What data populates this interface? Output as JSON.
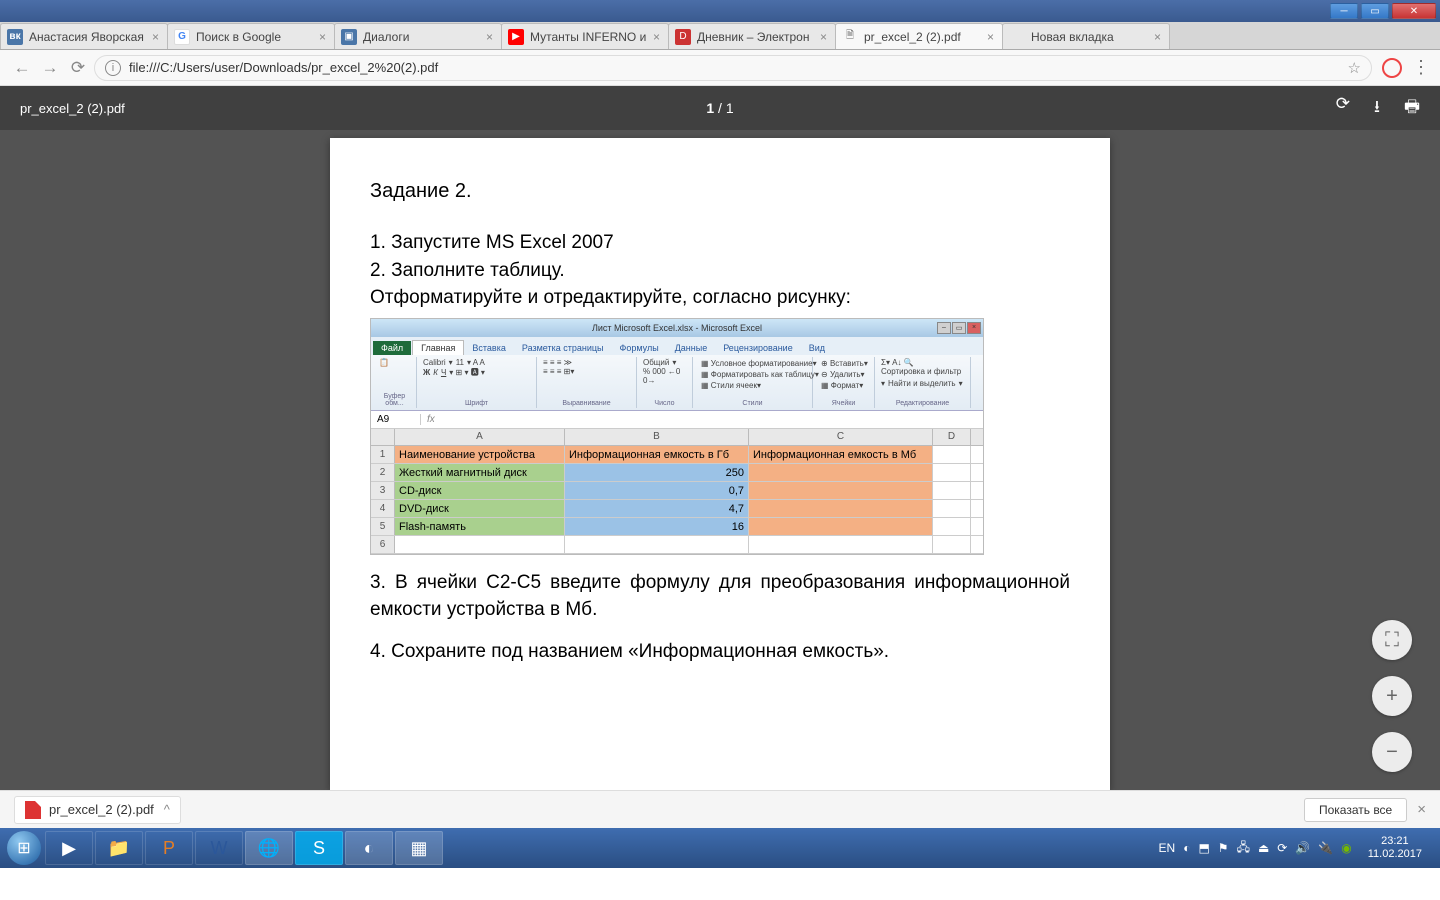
{
  "tabs": [
    {
      "label": "Анастасия Яворская",
      "fav": "vk",
      "favtxt": "вк"
    },
    {
      "label": "Поиск в Google",
      "fav": "g",
      "favtxt": "G"
    },
    {
      "label": "Диалоги",
      "fav": "dlg",
      "favtxt": "▣"
    },
    {
      "label": "Мутанты INFERNO и",
      "fav": "yt",
      "favtxt": "▶"
    },
    {
      "label": "Дневник – Электрон",
      "fav": "d",
      "favtxt": "D"
    },
    {
      "label": "pr_excel_2 (2).pdf",
      "fav": "pdf",
      "favtxt": "🗎",
      "active": true
    },
    {
      "label": "Новая вкладка",
      "fav": "pdf",
      "favtxt": ""
    }
  ],
  "url": "file:///C:/Users/user/Downloads/pr_excel_2%20(2).pdf",
  "pdf": {
    "filename": "pr_excel_2 (2).pdf",
    "page_cur": "1",
    "page_sep": "/",
    "page_tot": "1"
  },
  "doc": {
    "title": "Задание 2.",
    "l1": "1. Запустите MS Excel 2007",
    "l2": "2. Заполните таблицу.",
    "l3": "Отформатируйте и отредактируйте, согласно рисунку:",
    "l4": "3. В ячейки С2-С5 введите формулу для преобразования информационной емкости устройства в Мб.",
    "l5": "4. Сохраните под названием «Информационная емкость»."
  },
  "excel": {
    "title": "Лист Microsoft Excel.xlsx - Microsoft Excel",
    "tabs": {
      "file": "Файл",
      "home": "Главная",
      "insert": "Вставка",
      "layout": "Разметка страницы",
      "formulas": "Формулы",
      "data": "Данные",
      "review": "Рецензирование",
      "view": "Вид"
    },
    "groups": {
      "clip": "Буфер обм...",
      "font": "Шрифт",
      "align": "Выравнивание",
      "num": "Число",
      "styles": "Стили",
      "cells": "Ячейки",
      "edit": "Редактирование"
    },
    "ribbon": {
      "fontname": "Calibri",
      "fontsize": "11",
      "numfmt": "Общий",
      "cond": "Условное форматирование",
      "fmttbl": "Форматировать как таблицу",
      "cellsty": "Стили ячеек",
      "ins": "Вставить",
      "del": "Удалить",
      "fmt": "Формат",
      "sort": "Сортировка и фильтр",
      "find": "Найти и выделить"
    },
    "namebox": "A9",
    "cols": [
      "A",
      "B",
      "C",
      "D"
    ],
    "rows": [
      {
        "n": "1",
        "a": "Наименование устройства",
        "b": "Информационная емкость в Гб",
        "c": "Информационная емкость в Мб",
        "hdr": true
      },
      {
        "n": "2",
        "a": "Жесткий магнитный диск",
        "b": "250",
        "c": ""
      },
      {
        "n": "3",
        "a": "CD-диск",
        "b": "0,7",
        "c": ""
      },
      {
        "n": "4",
        "a": "DVD-диск",
        "b": "4,7",
        "c": ""
      },
      {
        "n": "5",
        "a": "Flash-память",
        "b": "16",
        "c": ""
      },
      {
        "n": "6",
        "a": "",
        "b": "",
        "c": "",
        "empty": true
      }
    ]
  },
  "download": {
    "file": "pr_excel_2 (2).pdf",
    "showall": "Показать все"
  },
  "tray": {
    "lang": "EN",
    "time": "23:21",
    "date": "11.02.2017"
  }
}
